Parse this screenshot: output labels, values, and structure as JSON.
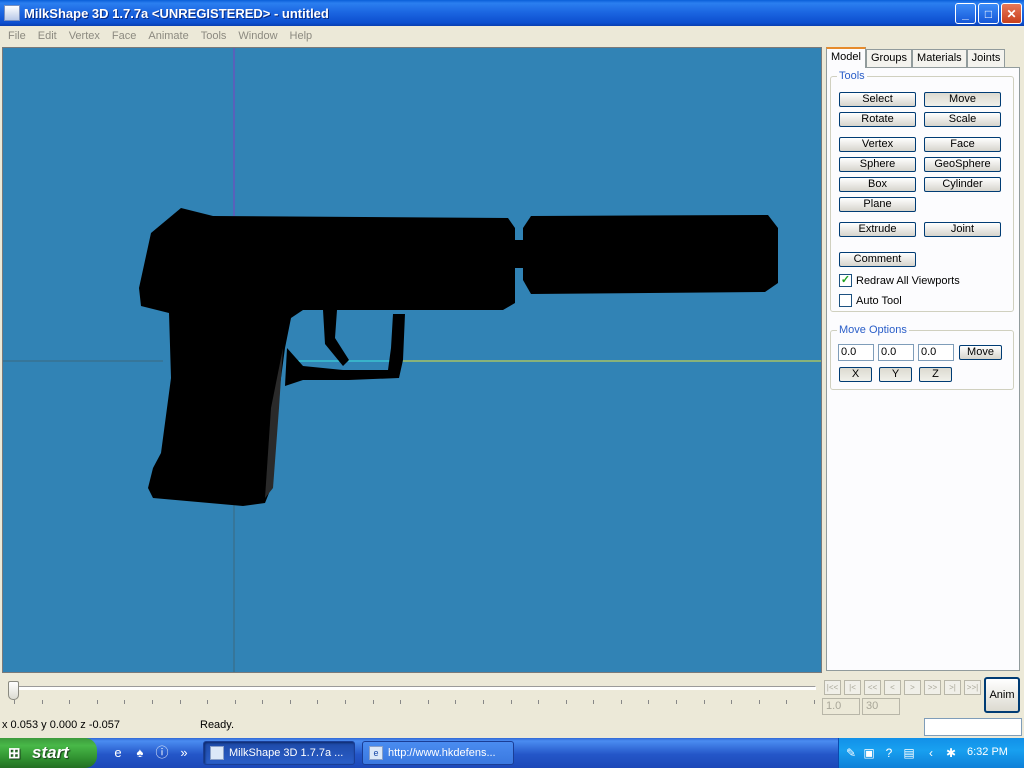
{
  "window": {
    "title": "MilkShape 3D 1.7.7a <UNREGISTERED> - untitled",
    "minimize": "_",
    "maximize": "□",
    "close": "✕"
  },
  "menu": [
    "File",
    "Edit",
    "Vertex",
    "Face",
    "Animate",
    "Tools",
    "Window",
    "Help"
  ],
  "colors": {
    "viewport_bg": "#3183b5",
    "model_fill": "#000000",
    "axis_x": "#e0e040",
    "axis_y": "#8040c0",
    "axis_z": "#40e0e0"
  },
  "panel": {
    "tabs": [
      "Model",
      "Groups",
      "Materials",
      "Joints"
    ],
    "active_tab": "Model",
    "tools_legend": "Tools",
    "tool_buttons": {
      "select": "Select",
      "move": "Move",
      "rotate": "Rotate",
      "scale": "Scale",
      "vertex": "Vertex",
      "face": "Face",
      "sphere": "Sphere",
      "geosphere": "GeoSphere",
      "box": "Box",
      "cylinder": "Cylinder",
      "plane": "Plane",
      "extrude": "Extrude",
      "joint": "Joint",
      "comment": "Comment"
    },
    "redraw_label": "Redraw All Viewports",
    "redraw_checked": "✓",
    "autotool_label": "Auto Tool",
    "move_legend": "Move Options",
    "move_x": "0.0",
    "move_y": "0.0",
    "move_z": "0.0",
    "move_button": "Move",
    "axis_x": "X",
    "axis_y": "Y",
    "axis_z": "Z"
  },
  "timeline": {
    "nav": [
      "|<<",
      "|<",
      "<<",
      "<",
      ">",
      ">>",
      ">|",
      ">>|"
    ],
    "frame_current": "1.0",
    "frame_total": "30",
    "anim_label": "Anim"
  },
  "status": {
    "coords": "x 0.053 y 0.000 z -0.057",
    "message": "Ready."
  },
  "taskbar": {
    "start": "start",
    "items": [
      "MilkShape 3D 1.7.7a ...",
      "http://www.hkdefens..."
    ],
    "clock": "6:32 PM",
    "quicklaunch_more": "»"
  }
}
